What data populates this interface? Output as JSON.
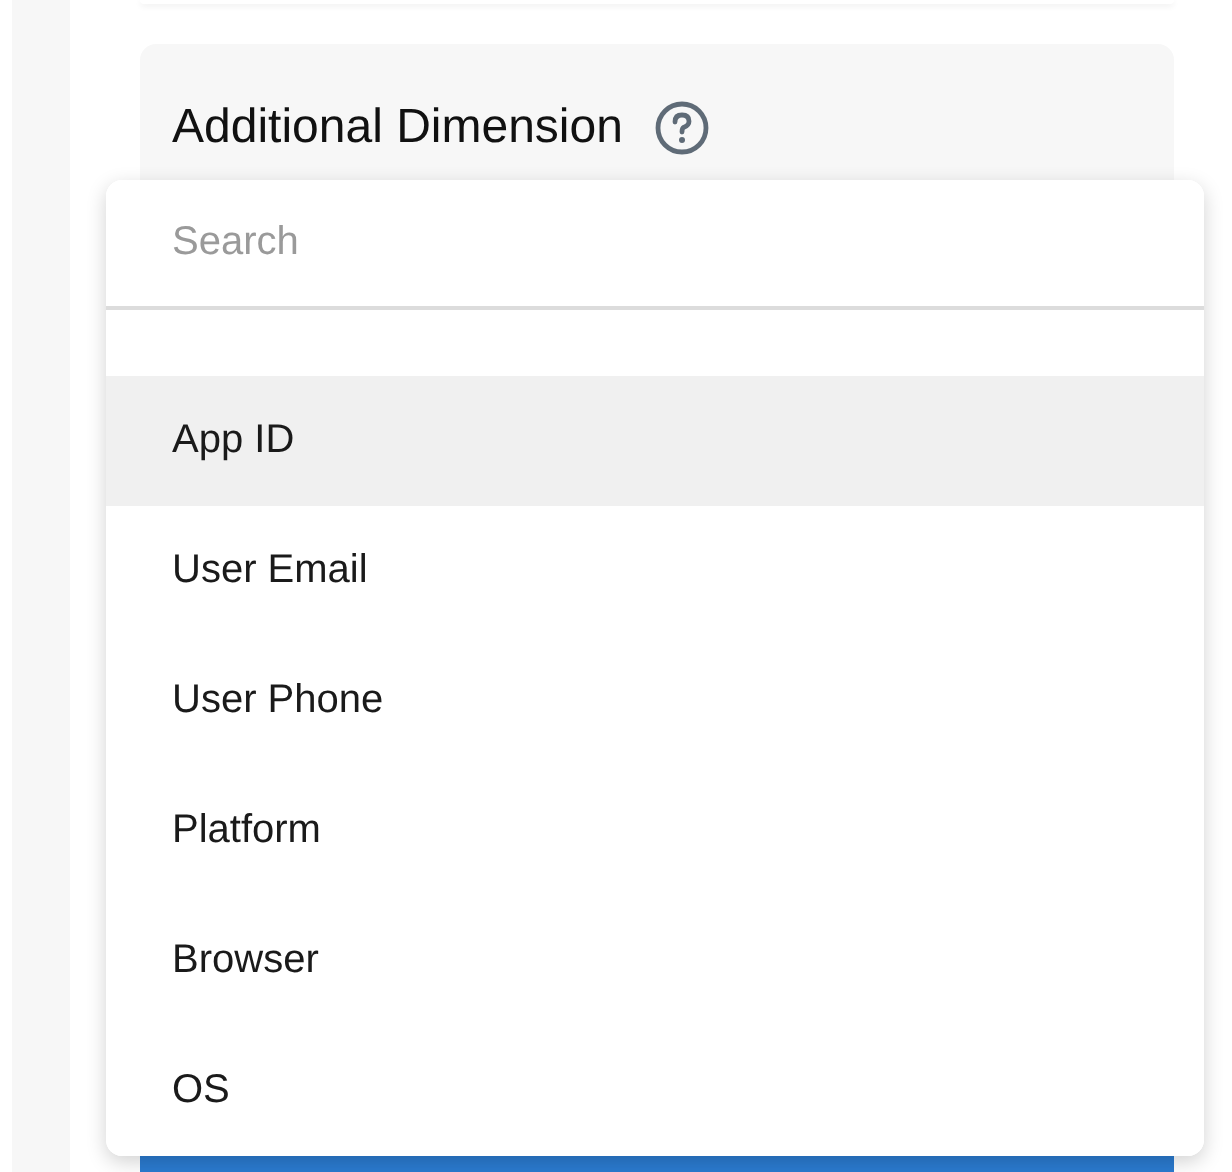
{
  "section": {
    "title": "Additional Dimension"
  },
  "dropdown": {
    "search": {
      "placeholder": "Search"
    },
    "options": [
      {
        "label": "App ID",
        "selected": true
      },
      {
        "label": "User Email",
        "selected": false
      },
      {
        "label": "User Phone",
        "selected": false
      },
      {
        "label": "Platform",
        "selected": false
      },
      {
        "label": "Browser",
        "selected": false
      },
      {
        "label": "OS",
        "selected": false
      }
    ]
  }
}
